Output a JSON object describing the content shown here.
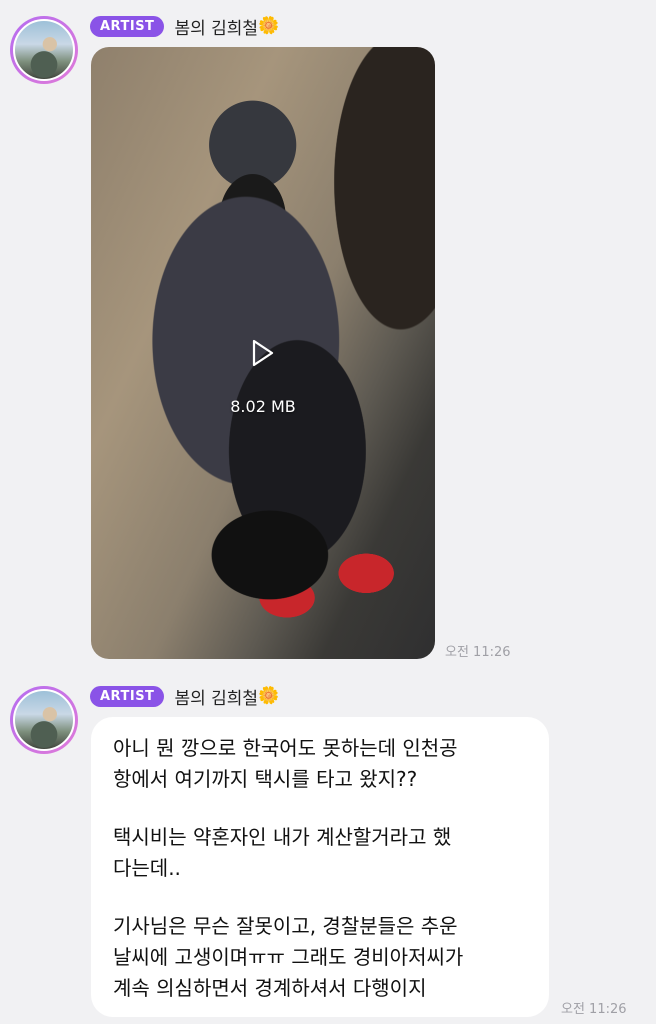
{
  "messages": [
    {
      "badge": "ARTIST",
      "sender": "봄의 김희철",
      "flower": "🌼",
      "type": "video",
      "video_size": "8.02 MB",
      "time": "오전 11:26"
    },
    {
      "badge": "ARTIST",
      "sender": "봄의 김희철",
      "flower": "🌼",
      "type": "text",
      "paragraphs": [
        "아니 뭔 깡으로 한국어도 못하는데 인천공\n항에서 여기까지 택시를 타고 왔지??",
        "택시비는 약혼자인 내가 계산할거라고 했\n다는데..",
        "기사님은 무슨 잘못이고, 경찰분들은 추운\n날씨에 고생이며ㅠㅠ 그래도 경비아저씨가\n계속 의심하면서 경계하셔서 다행이지"
      ],
      "time": "오전 11:26"
    }
  ],
  "icons": {
    "play": "play-icon",
    "flower": "flower-icon"
  },
  "colors": {
    "badge": "#8a53e7",
    "background": "#f1f1f3",
    "bubble": "#ffffff",
    "timestamp": "#a0a0a6"
  }
}
